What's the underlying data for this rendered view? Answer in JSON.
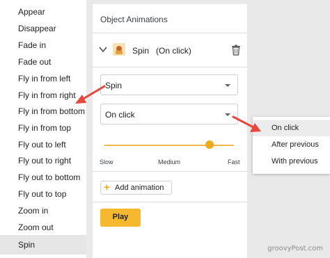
{
  "animation_list": {
    "items": [
      {
        "label": "Appear"
      },
      {
        "label": "Disappear"
      },
      {
        "label": "Fade in"
      },
      {
        "label": "Fade out"
      },
      {
        "label": "Fly in from left"
      },
      {
        "label": "Fly in from right"
      },
      {
        "label": "Fly in from bottom"
      },
      {
        "label": "Fly in from top"
      },
      {
        "label": "Fly out to left"
      },
      {
        "label": "Fly out to right"
      },
      {
        "label": "Fly out to bottom"
      },
      {
        "label": "Fly out to top"
      },
      {
        "label": "Zoom in"
      },
      {
        "label": "Zoom out"
      },
      {
        "label": "Spin"
      }
    ],
    "selected_label": "Spin"
  },
  "panel": {
    "title": "Object Animations",
    "animation_row": {
      "label": "Spin   (On click)",
      "thumbnail_icon": "image-thumbnail-icon",
      "delete_icon": "trash-icon"
    },
    "type_select": {
      "value": "Spin"
    },
    "trigger_select": {
      "value": "On click"
    },
    "speed_slider": {
      "value_fraction": 0.81,
      "ticks": [
        "Slow",
        "Medium",
        "Fast"
      ]
    },
    "add_animation_label": "Add animation",
    "play_label": "Play"
  },
  "trigger_menu": {
    "items": [
      {
        "label": "On click"
      },
      {
        "label": "After previous"
      },
      {
        "label": "With previous"
      }
    ],
    "highlighted": "On click"
  },
  "colors": {
    "accent": "#f5b82e",
    "annotation_arrow": "#e8473c",
    "selected_row": "#e6e6e6"
  },
  "watermark": "groovyPost.com"
}
